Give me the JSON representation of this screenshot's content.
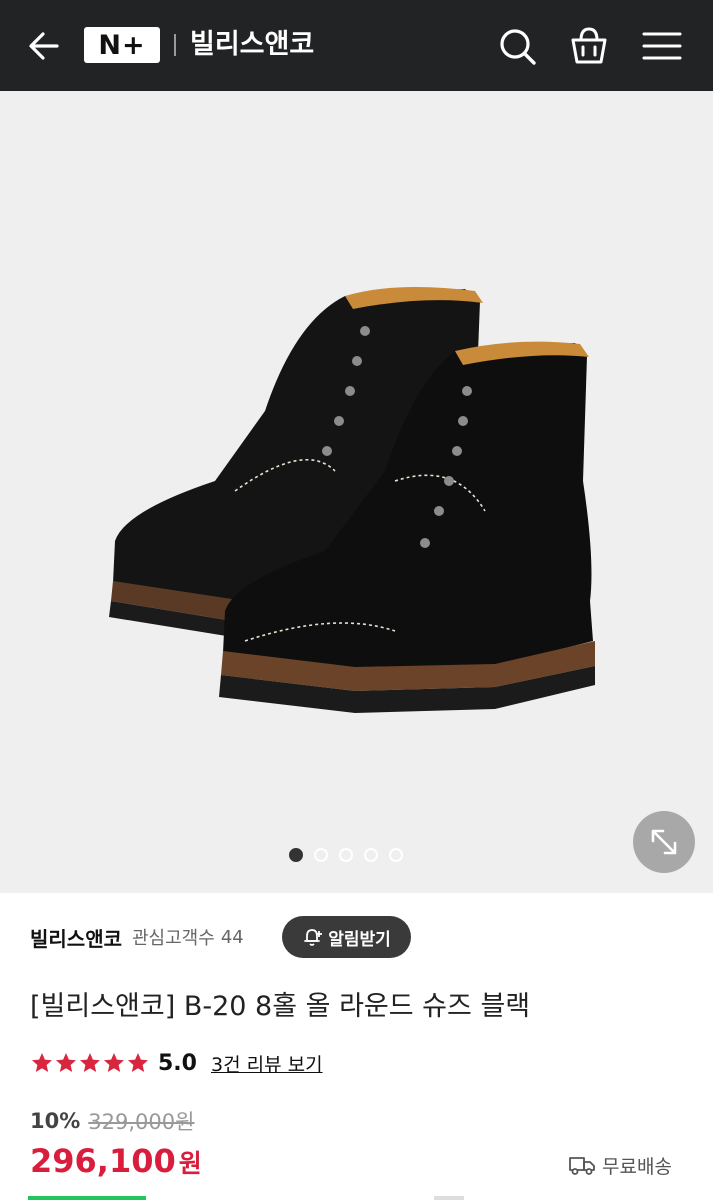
{
  "header": {
    "logo_text": "N+",
    "brand_title": "빌리스앤코",
    "icons": [
      "back-arrow-icon",
      "search-icon",
      "shopping-bag-icon",
      "menu-icon"
    ]
  },
  "gallery": {
    "image_count": 5,
    "active_index": 0,
    "zoom_icon": "expand-icon"
  },
  "seller": {
    "name": "빌리스앤코",
    "follower_label": "관심고객수",
    "follower_count": "44",
    "alarm_label": "알림받기"
  },
  "product": {
    "title": "[빌리스앤코] B-20 8홀 올 라운드 슈즈 블랙",
    "rating": "5.0",
    "star_count": 5,
    "review_link": "3건 리뷰 보기",
    "discount_rate": "10%",
    "original_price": "329,000원",
    "price": "296,100",
    "price_unit": "원",
    "shipping_label": "무료배송"
  },
  "colors": {
    "header_bg": "#222324",
    "price_red": "#d91e3d",
    "star_red": "#d9263f"
  }
}
